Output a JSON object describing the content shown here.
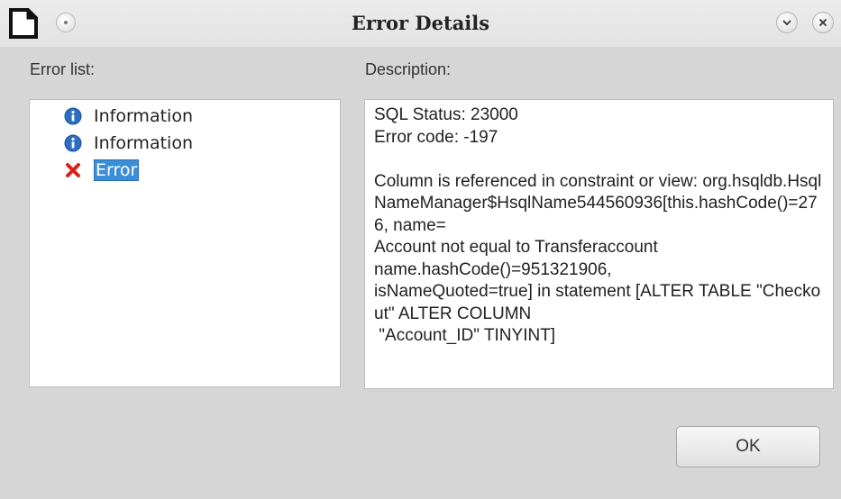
{
  "window": {
    "title": "Error Details",
    "app_icon": "libreoffice-doc-icon",
    "buttons": [
      "window-menu-icon",
      "minimize-icon",
      "close-icon"
    ]
  },
  "error_list": {
    "label": "Error list:",
    "items": [
      {
        "label": "Information",
        "icon": "info-icon",
        "icon_color": "#2a6fc4"
      },
      {
        "label": "Information",
        "icon": "info-icon",
        "icon_color": "#2a6fc4"
      },
      {
        "label": "Error",
        "icon": "error-x-icon",
        "icon_color": "#d9211a",
        "selected": true
      }
    ]
  },
  "description": {
    "label": "Description:",
    "text": "SQL Status: 23000\nError code: -197\n\nColumn is referenced in constraint or view: org.hsqldb.HsqlNameManager$HsqlName544560936[this.hashCode()=276, name=\nAccount not equal to Transferaccount\nname.hashCode()=951321906,\nisNameQuoted=true] in statement [ALTER TABLE \"Checkout\" ALTER COLUMN\n \"Account_ID\" TINYINT]"
  },
  "footer": {
    "ok_label": "OK"
  },
  "colors": {
    "selection": "#3b8fd8",
    "dialog_bg": "#d6d6d6"
  }
}
